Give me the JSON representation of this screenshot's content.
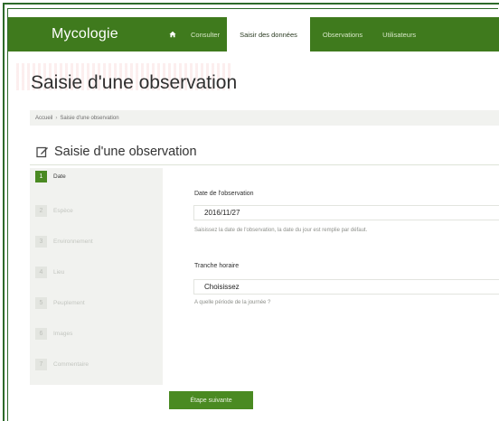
{
  "navbar": {
    "brand": "Mycologie",
    "home_icon": "home-icon",
    "items": [
      {
        "label": "Consulter"
      },
      {
        "label": "Saisir des données"
      },
      {
        "label": "Observations"
      },
      {
        "label": "Utilisateurs"
      }
    ],
    "active_index": 1
  },
  "page": {
    "title": "Saisie d'une observation",
    "breadcrumb": [
      "Accueil",
      "Saisie d'une observation"
    ],
    "breadcrumb_separator": "›"
  },
  "section": {
    "title": "Saisie d'une observation",
    "icon": "edit-icon"
  },
  "steps": [
    {
      "number": "1",
      "label": "Date"
    },
    {
      "number": "2",
      "label": "Espèce"
    },
    {
      "number": "3",
      "label": "Environnement"
    },
    {
      "number": "4",
      "label": "Lieu"
    },
    {
      "number": "5",
      "label": "Peuplement"
    },
    {
      "number": "6",
      "label": "Images"
    },
    {
      "number": "7",
      "label": "Commentaire"
    }
  ],
  "form": {
    "date_label": "Date de l'observation",
    "date_value": "2016/11/27",
    "date_help": "Saisissez la date de l'observation, la date du jour est remplie par défaut.",
    "time_label": "Tranche horaire",
    "time_value": "Choisissez",
    "time_help": "A quelle période de la journée ?"
  },
  "buttons": {
    "next": "Étape suivante"
  },
  "colors": {
    "navbar": "#3f7a1d",
    "accent": "#4a8a22",
    "frame": "#2d6a2a"
  }
}
